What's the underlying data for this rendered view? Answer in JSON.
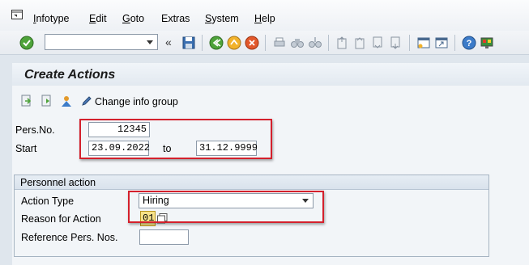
{
  "menubar": {
    "items": [
      "Infotype",
      "Edit",
      "Goto",
      "Extras",
      "System",
      "Help"
    ],
    "underline_first": [
      true,
      true,
      true,
      false,
      true,
      true
    ]
  },
  "toolbar": {
    "command_field": "",
    "icons": [
      "enter-check-icon",
      "save-icon",
      "back-icon",
      "exit-icon",
      "cancel-icon",
      "print-icon",
      "find-icon",
      "find-next-icon",
      "first-page-icon",
      "previous-page-icon",
      "next-page-icon",
      "last-page-icon",
      "create-session-icon",
      "shortcut-icon",
      "help-icon",
      "customize-layout-icon"
    ]
  },
  "page": {
    "title": "Create Actions"
  },
  "app_toolbar": {
    "change_info_group": "Change info group"
  },
  "header_fields": {
    "pers_no_label": "Pers.No.",
    "pers_no_value": "12345",
    "start_label": "Start",
    "start_value": "23.09.2022",
    "to_label": "to",
    "end_value": "31.12.9999"
  },
  "personnel_action": {
    "group_title": "Personnel action",
    "action_type_label": "Action Type",
    "action_type_value": "Hiring",
    "reason_label": "Reason for Action",
    "reason_value": "01",
    "reference_label": "Reference Pers. Nos.",
    "reference_value": ""
  },
  "colors": {
    "highlight_border": "#d4202c",
    "background": "#dfe6ed",
    "reason_field_bg": "#f7e28a"
  }
}
